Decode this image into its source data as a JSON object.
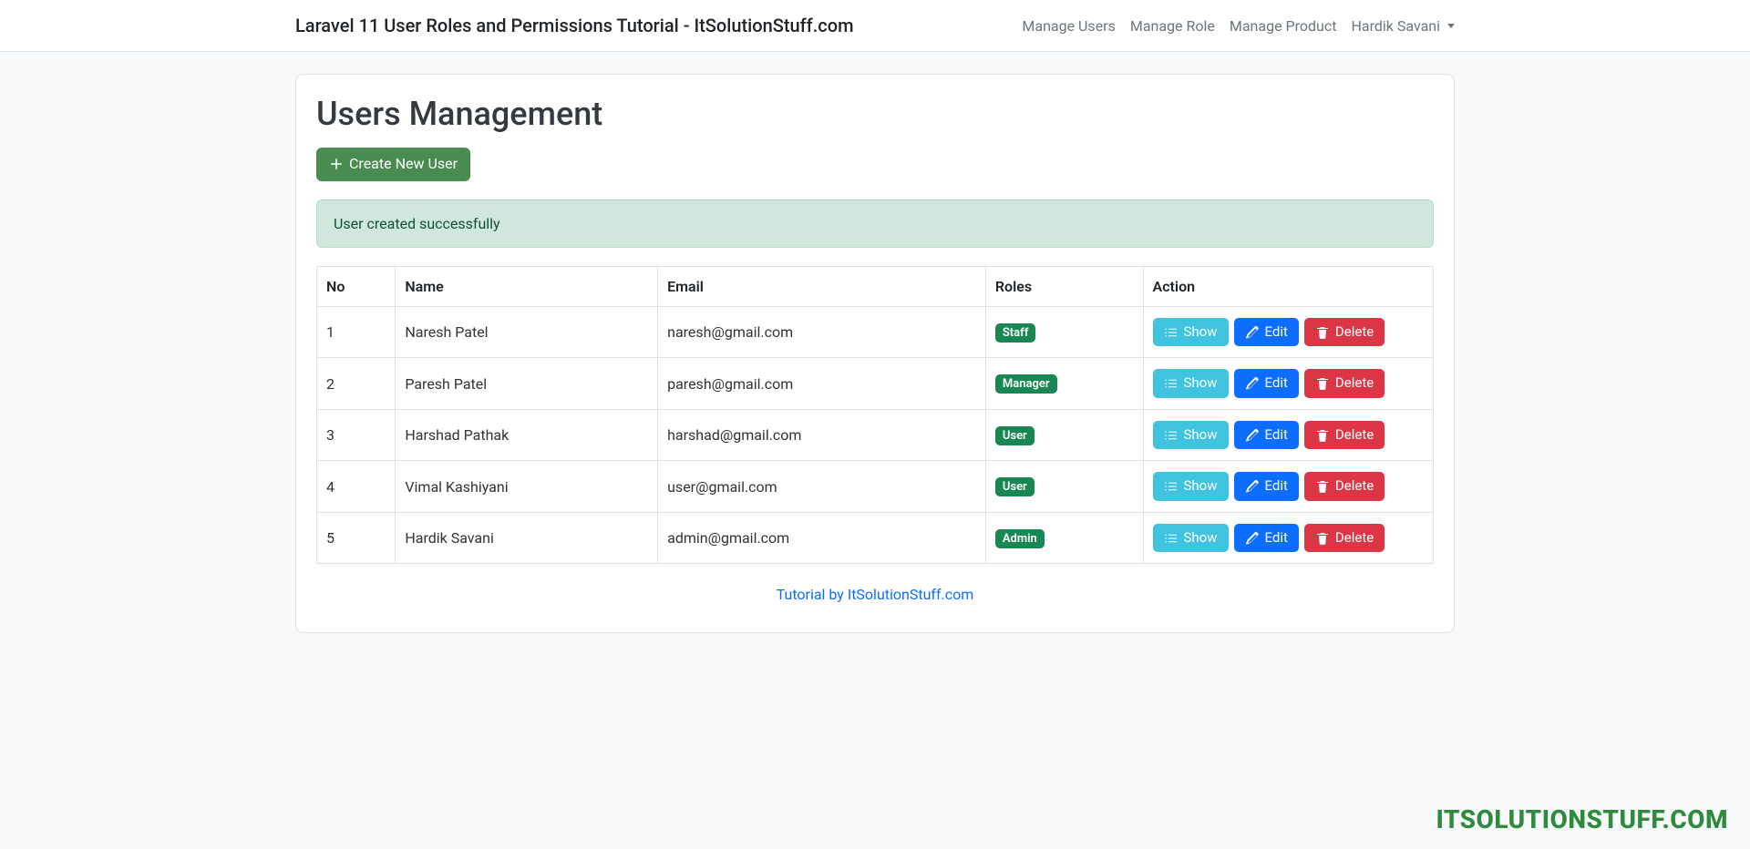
{
  "navbar": {
    "brand": "Laravel 11 User Roles and Permissions Tutorial - ItSolutionStuff.com",
    "links": [
      {
        "label": "Manage Users"
      },
      {
        "label": "Manage Role"
      },
      {
        "label": "Manage Product"
      }
    ],
    "user_dropdown": "Hardik Savani"
  },
  "page": {
    "title": "Users Management",
    "create_button": "Create New User",
    "alert": "User created successfully",
    "footer_text": "Tutorial by ItSolutionStuff.com"
  },
  "table": {
    "headers": {
      "no": "No",
      "name": "Name",
      "email": "Email",
      "roles": "Roles",
      "action": "Action"
    },
    "action_labels": {
      "show": "Show",
      "edit": "Edit",
      "delete": "Delete"
    },
    "rows": [
      {
        "no": "1",
        "name": "Naresh Patel",
        "email": "naresh@gmail.com",
        "role": "Staff"
      },
      {
        "no": "2",
        "name": "Paresh Patel",
        "email": "paresh@gmail.com",
        "role": "Manager"
      },
      {
        "no": "3",
        "name": "Harshad Pathak",
        "email": "harshad@gmail.com",
        "role": "User"
      },
      {
        "no": "4",
        "name": "Vimal Kashiyani",
        "email": "user@gmail.com",
        "role": "User"
      },
      {
        "no": "5",
        "name": "Hardik Savani",
        "email": "admin@gmail.com",
        "role": "Admin"
      }
    ]
  },
  "watermark": "ITSOLUTIONSTUFF.COM"
}
